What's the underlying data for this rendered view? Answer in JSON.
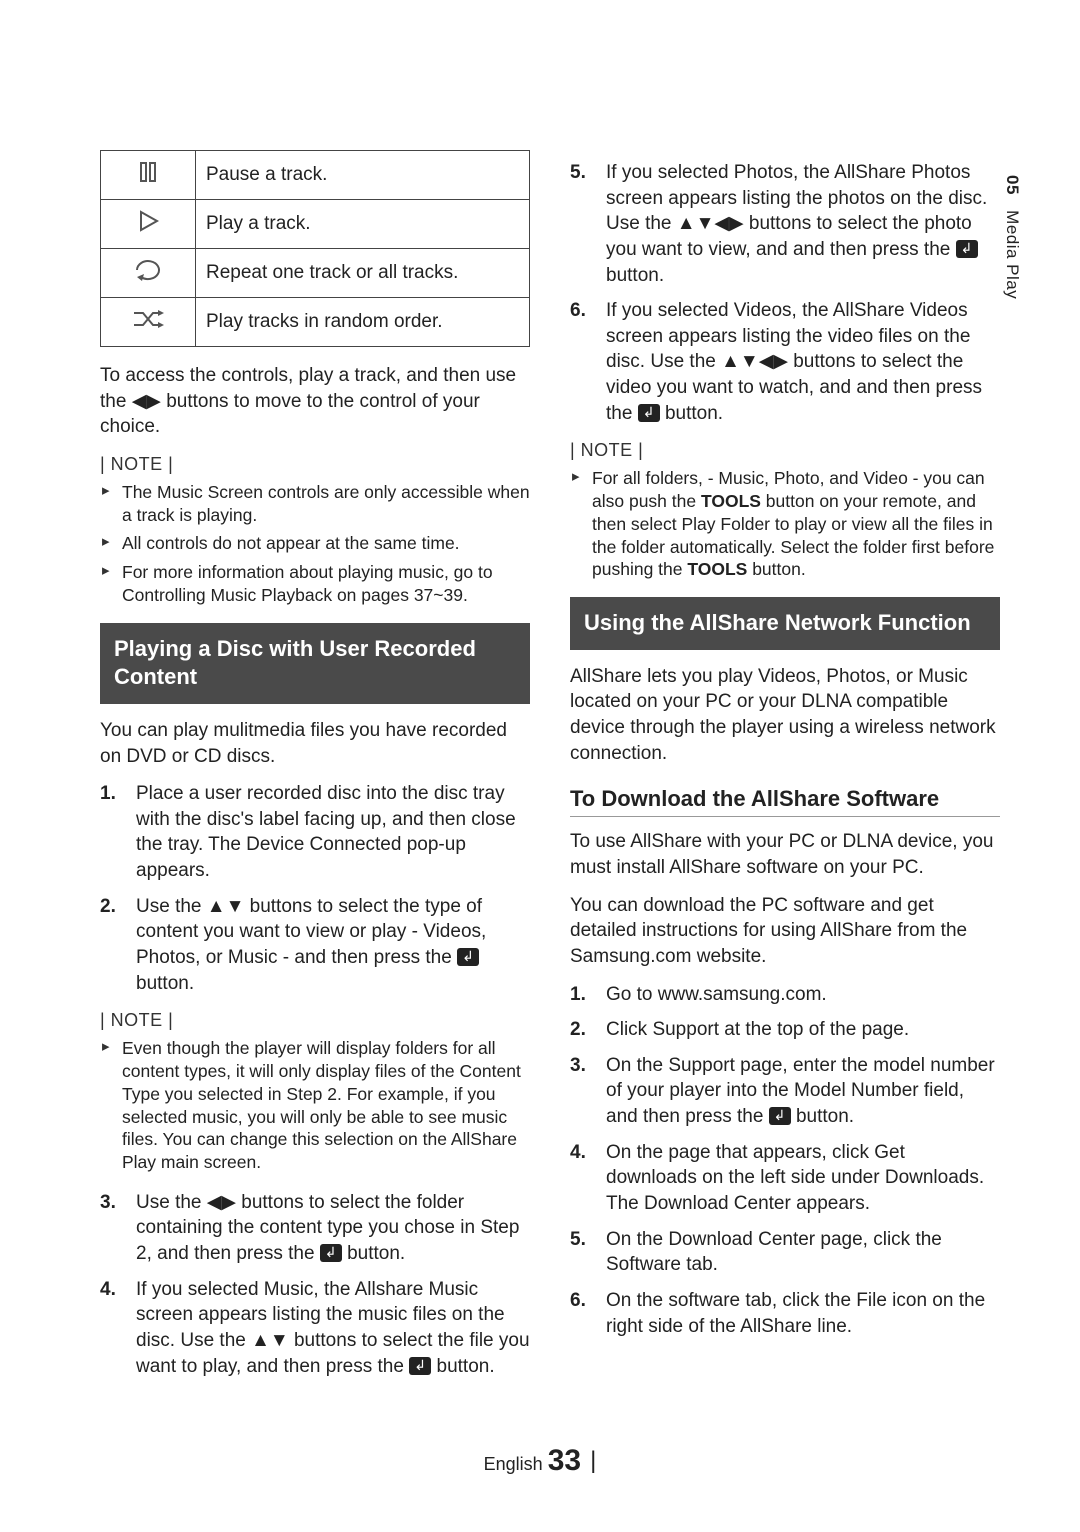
{
  "sideTab": {
    "chapter": "05",
    "title": "Media Play"
  },
  "controlsTable": [
    {
      "iconName": "pause-icon",
      "desc": "Pause a track."
    },
    {
      "iconName": "play-icon",
      "desc": "Play a track."
    },
    {
      "iconName": "repeat-icon",
      "desc": "Repeat one track or all tracks."
    },
    {
      "iconName": "shuffle-icon",
      "desc": "Play tracks in random order."
    }
  ],
  "leftCol": {
    "accessControls": "To access the controls, play a track, and then use the ◀▶ buttons to move to the control of your choice.",
    "noteHead": "| NOTE |",
    "notes1": [
      "The Music Screen controls are only accessible when a track is playing.",
      "All controls do not appear at the same time.",
      "For more information about playing music, go to Controlling Music Playback on pages 37~39."
    ],
    "sectionTitle": "Playing a Disc with User Recorded Content",
    "intro": "You can play mulitmedia files you have recorded on DVD or CD discs.",
    "steps": [
      "Place a user recorded disc into the disc tray with the disc's label facing up, and then close the tray. The Device Connected pop-up appears.",
      "Use the ▲▼ buttons to select the type of content you want to view or play - Videos, Photos, or Music - and then press the E button."
    ],
    "notes2": [
      "Even though the player will display folders for all content types, it will only display files of the Content Type you selected in Step 2. For example, if you selected music, you will only be able to see music files. You can change this selection on the AllShare Play main screen."
    ],
    "steps2": [
      "Use the ◀▶ buttons to select the folder containing the content type you chose in Step 2, and then press the E button.",
      "If you selected Music, the Allshare Music screen appears listing the music files on the disc. Use the ▲▼ buttons to select the file you want to play, and then press the E button."
    ]
  },
  "rightCol": {
    "steps3": [
      "If you selected Photos, the AllShare Photos screen appears listing the photos on the disc. Use the ▲▼◀▶ buttons to select the photo you want to view, and and then press the E button.",
      "If you selected Videos, the AllShare Videos screen appears listing the video files on the disc. Use the ▲▼◀▶ buttons to select the video you want to watch, and and then press the E button."
    ],
    "noteHead": "| NOTE |",
    "notes3": [
      "For all folders, - Music, Photo, and Video - you can also push the TOOLS button on your remote, and then select Play Folder to play or view all the files in the folder automatically. Select the folder first before pushing the TOOLS button."
    ],
    "sectionTitle": "Using the AllShare Network Function",
    "allshareIntro": "AllShare lets you play Videos, Photos, or Music located on your PC or your DLNA compatible device through the player using a wireless network connection.",
    "subhead": "To Download the AllShare Software",
    "usePara1": "To use AllShare with your PC or DLNA device, you must install AllShare software on your PC.",
    "usePara2": "You can download the PC software and get detailed instructions for using AllShare from the Samsung.com website.",
    "downloadSteps": [
      "Go to www.samsung.com.",
      "Click Support at the top of the page.",
      "On the Support page, enter the model number of your player into the Model Number field, and then press the E button.",
      "On the page that appears, click Get downloads on the left side under Downloads. The Download Center appears.",
      "On the Download Center page, click the Software tab.",
      "On the software tab, click the File icon on the right side of the AllShare line."
    ]
  },
  "footer": {
    "lang": "English",
    "page": "33"
  }
}
